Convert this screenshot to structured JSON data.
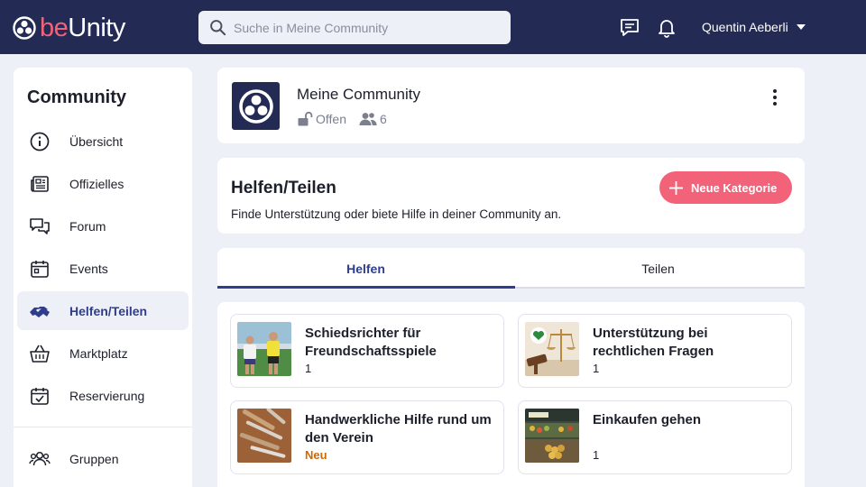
{
  "app": {
    "brand_be": "be",
    "brand_unity": "Unity",
    "brand_color": "#f26379",
    "nav_color": "#232b55",
    "accent_color": "#2f3d8c"
  },
  "header": {
    "search_placeholder": "Suche in Meine Community",
    "user_name": "Quentin Aeberli",
    "icons": [
      "chat-icon",
      "bell-icon",
      "caret-down-icon"
    ]
  },
  "sidebar": {
    "title": "Community",
    "items": [
      {
        "label": "Übersicht",
        "icon": "info-icon",
        "active": false
      },
      {
        "label": "Offizielles",
        "icon": "newspaper-icon",
        "active": false
      },
      {
        "label": "Forum",
        "icon": "forum-icon",
        "active": false
      },
      {
        "label": "Events",
        "icon": "calendar-icon",
        "active": false
      },
      {
        "label": "Helfen/Teilen",
        "icon": "handshake-icon",
        "active": true
      },
      {
        "label": "Marktplatz",
        "icon": "basket-icon",
        "active": false
      },
      {
        "label": "Reservierung",
        "icon": "calendar-check-icon",
        "active": false
      },
      {
        "label": "Gruppen",
        "icon": "group-icon",
        "active": false
      }
    ]
  },
  "community": {
    "name": "Meine Community",
    "visibility": "Offen",
    "members": "6"
  },
  "section": {
    "title": "Helfen/Teilen",
    "description": "Finde Unterstützung oder biete Hilfe in deiner Community an.",
    "new_category_label": "Neue Kategorie"
  },
  "tabs": [
    {
      "label": "Helfen",
      "active": true
    },
    {
      "label": "Teilen",
      "active": false
    }
  ],
  "categories": [
    {
      "title": "Schiedsrichter für Freundschaftsspiele",
      "count": "1",
      "image": "soccer-referee-image"
    },
    {
      "title": "Unterstützung bei rechtlichen Fragen",
      "count": "1",
      "image": "justice-scales-image"
    },
    {
      "title": "Handwerkliche Hilfe rund um den Verein",
      "badge": "Neu",
      "image": "tools-image"
    },
    {
      "title": "Einkaufen gehen",
      "count": "1",
      "image": "grocery-store-image"
    }
  ]
}
